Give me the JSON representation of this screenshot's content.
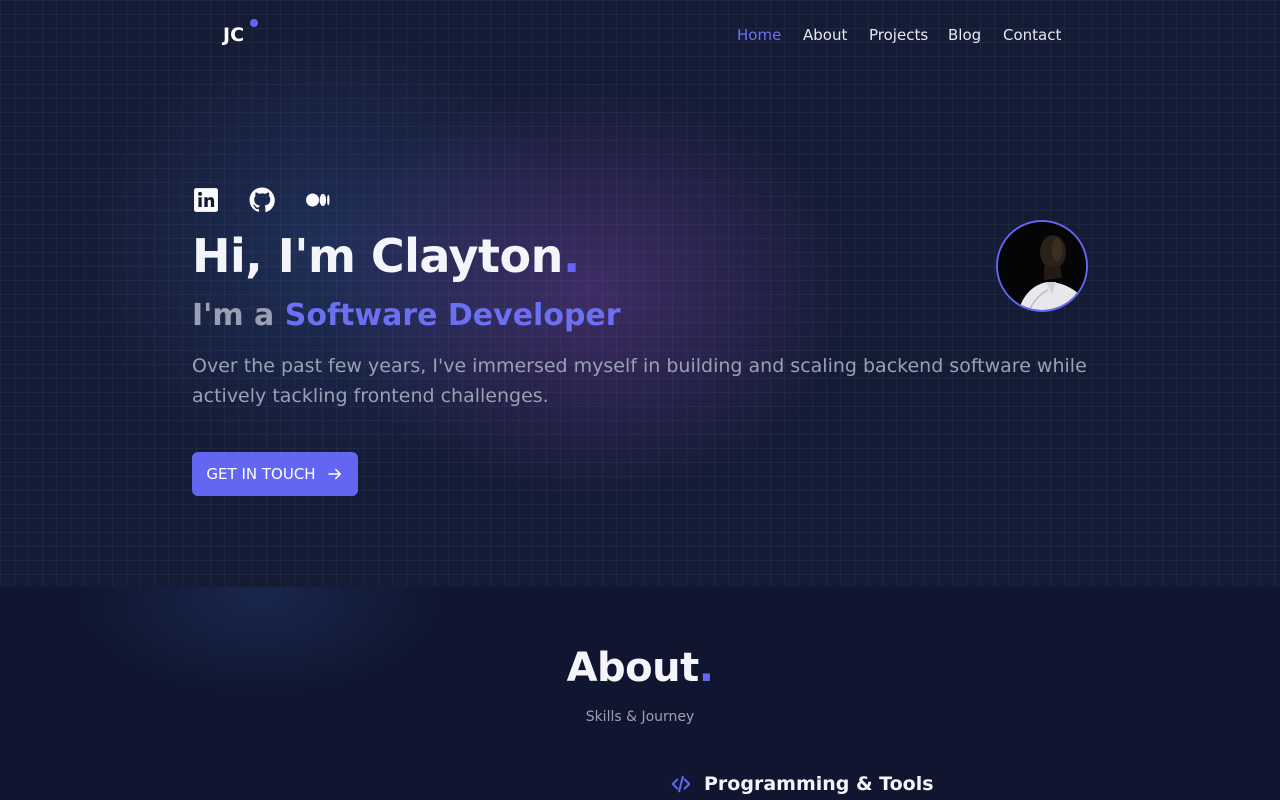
{
  "header": {
    "logo": "JC",
    "nav": [
      {
        "label": "Home",
        "active": true
      },
      {
        "label": "About",
        "active": false
      },
      {
        "label": "Projects",
        "active": false
      },
      {
        "label": "Blog",
        "active": false
      },
      {
        "label": "Contact",
        "active": false
      }
    ]
  },
  "hero": {
    "socials": [
      "linkedin-icon",
      "github-icon",
      "medium-icon"
    ],
    "greeting": "Hi, I'm Clayton",
    "greeting_dot": ".",
    "role_prefix": "I'm a",
    "role_title": "Software Developer",
    "bio": "Over the past few years, I've immersed myself in building and scaling backend software while actively tackling frontend challenges.",
    "cta_label": "GET IN TOUCH",
    "cta_icon": "arrow-right-icon"
  },
  "about": {
    "title": "About",
    "title_dot": ".",
    "subtitle": "Skills & Journey",
    "section_icon": "code-icon",
    "section_label": "Programming & Tools"
  },
  "colors": {
    "accent": "#6366f1",
    "background": "#141b35",
    "muted_text": "#9aa0b4"
  }
}
